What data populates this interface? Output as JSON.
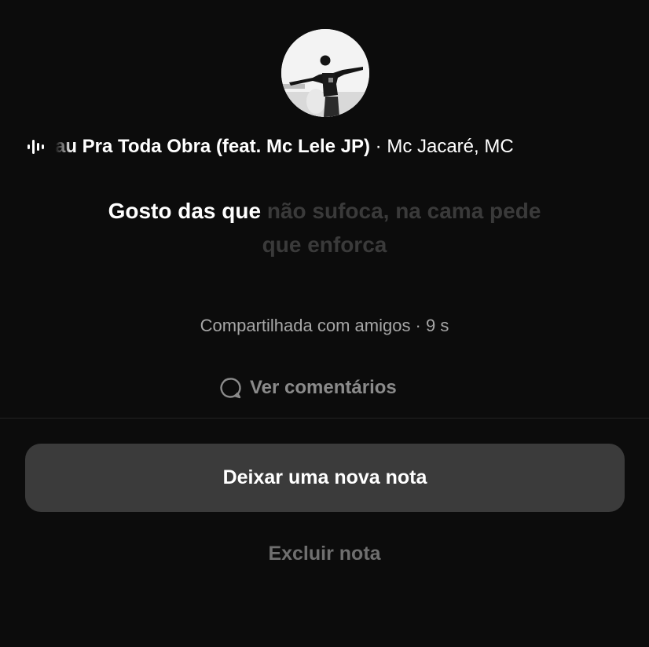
{
  "avatar": {
    "icon": "user-photo"
  },
  "track": {
    "icon": "audio-wave-icon",
    "title": "au Pra Toda Obra (feat. Mc Lele JP)",
    "separator": " · ",
    "artists": "Mc Jacaré, MC"
  },
  "lyrics": {
    "line_active": "Gosto das que",
    "line_upcoming_1": " não sufoca, na cama pede",
    "line_upcoming_2": "que enforca"
  },
  "meta": {
    "shared_with": "Compartilhada com amigos · 9 s"
  },
  "comments": {
    "icon": "speech-bubble-icon",
    "label": "Ver comentários"
  },
  "actions": {
    "new_note_label": "Deixar uma nova nota",
    "delete_note_label": "Excluir nota"
  },
  "colors": {
    "background": "#0c0c0c",
    "button_bg": "#3b3b3b",
    "muted_text": "#a6a6a6",
    "upcoming_lyric": "#3a3a3a"
  }
}
